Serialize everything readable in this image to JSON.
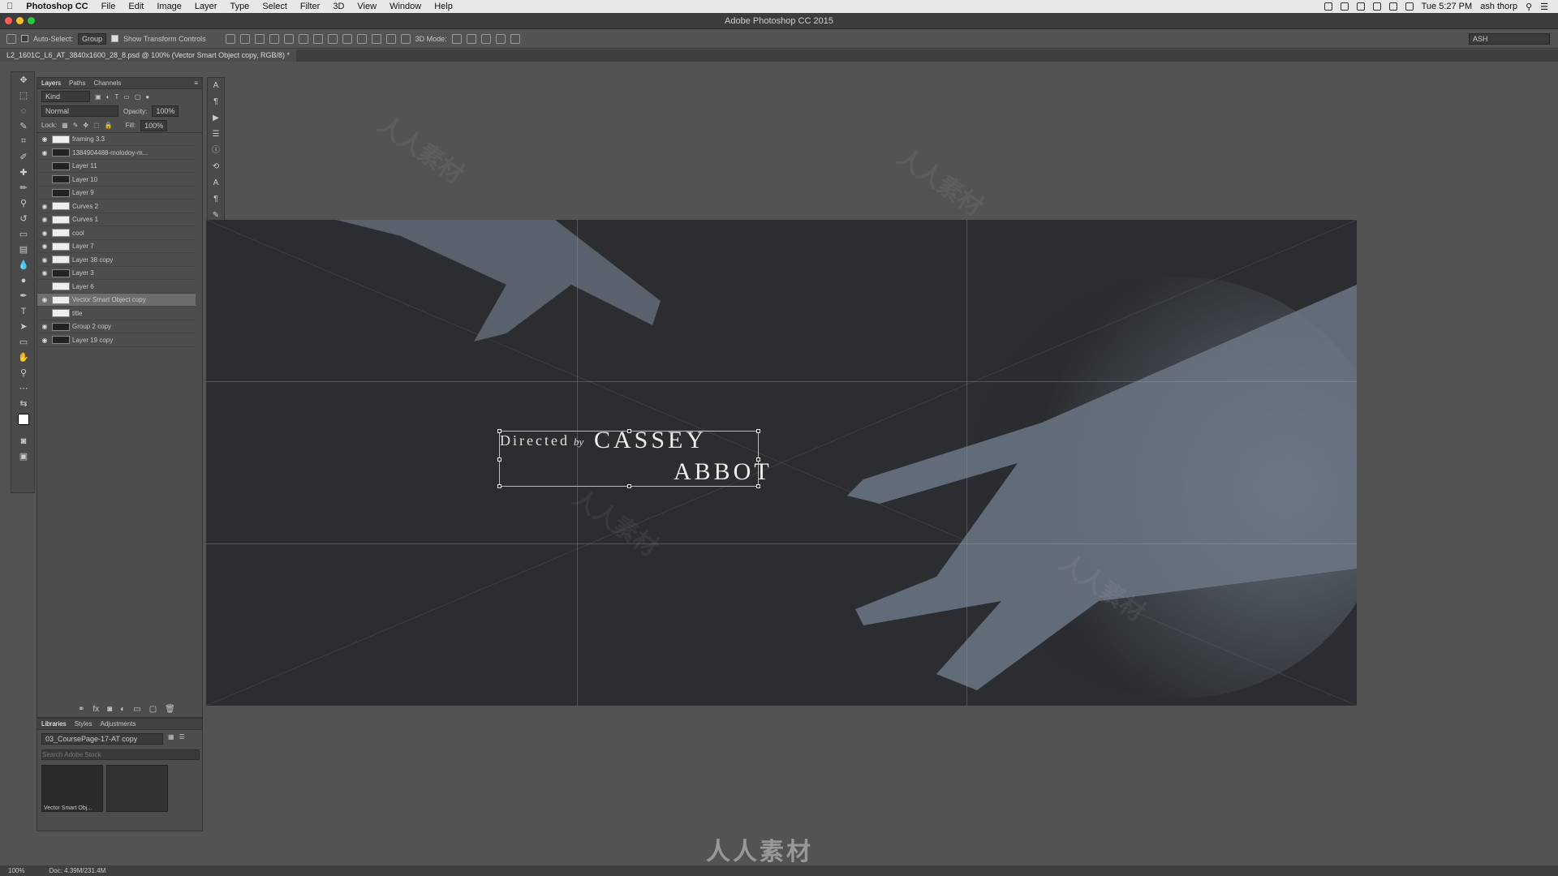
{
  "menubar": {
    "apple": "",
    "app": "Photoshop CC",
    "items": [
      "File",
      "Edit",
      "Image",
      "Layer",
      "Type",
      "Select",
      "Filter",
      "3D",
      "View",
      "Window",
      "Help"
    ],
    "clock": "Tue 5:27 PM",
    "user": "ash thorp"
  },
  "window": {
    "title": "Adobe Photoshop CC 2015"
  },
  "options": {
    "auto_select_label": "Auto-Select:",
    "auto_select_value": "Group",
    "transform_label": "Show Transform Controls",
    "mode_3d": "3D Mode:",
    "workspace": "ASH"
  },
  "document": {
    "tab_title": "L2_1601C_L6_AT_3840x1600_28_8.psd @ 100% (Vector Smart Object copy, RGB/8) *"
  },
  "layers_panel": {
    "tabs": [
      "Layers",
      "Paths",
      "Channels"
    ],
    "filter": "Kind",
    "blend_mode": "Normal",
    "opacity_label": "Opacity:",
    "opacity_value": "100%",
    "lock_label": "Lock:",
    "fill_label": "Fill:",
    "fill_value": "100%",
    "layers": [
      {
        "name": "framing 3.3",
        "visible": true,
        "thumb": "white",
        "selected": false
      },
      {
        "name": "1384904488-molodoy-m...",
        "visible": true,
        "thumb": "dark",
        "selected": false
      },
      {
        "name": "Layer 11",
        "visible": false,
        "thumb": "dark",
        "selected": false
      },
      {
        "name": "Layer 10",
        "visible": false,
        "thumb": "dark",
        "selected": false
      },
      {
        "name": "Layer 9",
        "visible": false,
        "thumb": "dark",
        "selected": false
      },
      {
        "name": "Curves 2",
        "visible": true,
        "thumb": "white",
        "selected": false
      },
      {
        "name": "Curves 1",
        "visible": true,
        "thumb": "white",
        "selected": false
      },
      {
        "name": "cool",
        "visible": true,
        "thumb": "white",
        "selected": false
      },
      {
        "name": "Layer 7",
        "visible": true,
        "thumb": "white",
        "selected": false
      },
      {
        "name": "Layer 38 copy",
        "visible": true,
        "thumb": "white",
        "selected": false
      },
      {
        "name": "Layer 3",
        "visible": true,
        "thumb": "dark",
        "selected": false
      },
      {
        "name": "Layer 6",
        "visible": false,
        "thumb": "white",
        "selected": false
      },
      {
        "name": "Vector Smart Object copy",
        "visible": true,
        "thumb": "white",
        "selected": true
      },
      {
        "name": "title",
        "visible": false,
        "thumb": "white",
        "selected": false
      },
      {
        "name": "Group 2 copy",
        "visible": true,
        "thumb": "dark",
        "selected": false
      },
      {
        "name": "Layer 19 copy",
        "visible": true,
        "thumb": "dark",
        "selected": false
      }
    ]
  },
  "libraries_panel": {
    "tabs": [
      "Libraries",
      "Styles",
      "Adjustments"
    ],
    "library": "03_CoursePage-17-AT copy",
    "search_placeholder": "Search Adobe Stock",
    "item_label": "Vector Smart Obj..."
  },
  "canvas_text": {
    "directed": "Directed",
    "by": "by",
    "cassey": "CASSEY",
    "abbot": "ABBOT"
  },
  "status": {
    "zoom": "100%",
    "doc": "Doc: 4.39M/231.4M"
  },
  "watermark": "人人素材"
}
